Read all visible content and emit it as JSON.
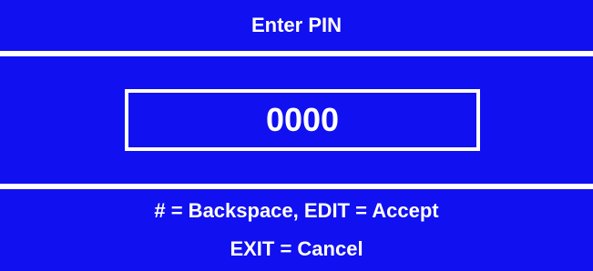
{
  "header": {
    "title": "Enter PIN"
  },
  "pin_entry": {
    "value": "0000"
  },
  "footer": {
    "instruction_1": "# = Backspace, EDIT = Accept",
    "instruction_2": "EXIT = Cancel"
  },
  "colors": {
    "background": "#1010f0",
    "text": "#ffffff",
    "separator": "#ffffff"
  }
}
